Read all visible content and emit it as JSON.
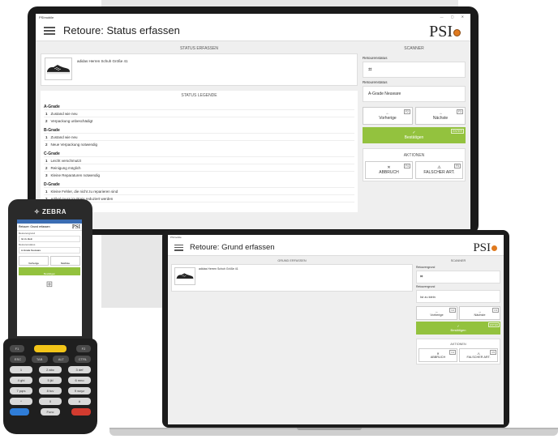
{
  "monitor": {
    "window_title": "PSImobile",
    "page_title": "Retoure: Status erfassen",
    "brand": "PSI",
    "left": {
      "section_status": "STATUS ERFASSEN",
      "product_name": "adidas Herren Schuh Größe 41",
      "section_legend": "STATUS LEGENDE",
      "grades": [
        {
          "title": "A-Grade",
          "rows": [
            {
              "n": "1",
              "t": "Zustand wie neu"
            },
            {
              "n": "2",
              "t": "Verpackung unbeschädigt"
            }
          ]
        },
        {
          "title": "B-Grade",
          "rows": [
            {
              "n": "1",
              "t": "Zustand wie neu"
            },
            {
              "n": "2",
              "t": "Neue Verpackung notwendig"
            }
          ]
        },
        {
          "title": "C-Grade",
          "rows": [
            {
              "n": "1",
              "t": "Leicht verschmutzt"
            },
            {
              "n": "2",
              "t": "Reinigung möglich"
            },
            {
              "n": "3",
              "t": "Kleine Reparaturen notwendig"
            }
          ]
        },
        {
          "title": "D-Grade",
          "rows": [
            {
              "n": "1",
              "t": "Kleine Fehler, die nicht zu reparieren sind"
            },
            {
              "n": "2",
              "t": "Artikel muss im Preis reduziert werden"
            }
          ]
        }
      ],
      "partial_line": "werden"
    },
    "right": {
      "section_scanner": "SCANNER",
      "label_1": "Retourenstatus",
      "label_2": "Retourenstatus",
      "status_value": "A-Grade Neuware",
      "prev_label": "Vorherige",
      "prev_key": "F2",
      "next_label": "Nächste",
      "next_key": "F3",
      "confirm_label": "Bestätigen",
      "confirm_key": "ENTER",
      "section_actions": "AKTIONEN",
      "abort_label": "ABBRUCH",
      "abort_key": "F4",
      "wrong_label": "FALSCHER ART.",
      "wrong_key": "F5"
    }
  },
  "laptop": {
    "window_title": "PSImobile",
    "page_title": "Retoure: Grund erfassen",
    "brand": "PSI",
    "section_grund": "GRUND ERFASSEN",
    "product_name": "adidas Herren Schuh Größe 41",
    "section_scanner": "SCANNER",
    "label_1": "Retourengrund",
    "label_2": "Retourengrund",
    "grund_value": "Ist zu klein",
    "prev_label": "Vorherige",
    "prev_key": "F2",
    "next_label": "Nächste",
    "next_key": "F3",
    "confirm_label": "Bestätigen",
    "confirm_key": "ENTER",
    "section_actions": "AKTIONEN",
    "abort_label": "ABBRUCH",
    "abort_key": "F4",
    "wrong_label": "FALSCHER ART.",
    "wrong_key": "F5"
  },
  "device": {
    "brand": "ZEBRA",
    "screen_brand": "PSI",
    "screen_title": "Retoure: Grund erfassen",
    "label_a": "Retourengrund",
    "value_a": "Ist zu klein",
    "label_b": "Retourenstatus",
    "value_b": "A-Grade Neuware",
    "prev_label": "Vorherige",
    "next_label": "Nächste",
    "confirm_label": "Bestätigen",
    "keys_row1": [
      "F1",
      "",
      "",
      "F2"
    ],
    "keys_row2": [
      "ESC",
      "TAB",
      "ALT",
      "CTRL"
    ],
    "keys_row3": [
      "1",
      "2 abc",
      "3 def"
    ],
    "keys_row4": [
      "4 ghi",
      "5 jkl",
      "6 mno"
    ],
    "keys_row5": [
      "7 pqrs",
      "8 tuv",
      "9 wxyz"
    ],
    "keys_row6": [
      "*",
      "0",
      "#"
    ],
    "keys_row7": [
      "",
      "Func",
      "SHIFT"
    ]
  }
}
